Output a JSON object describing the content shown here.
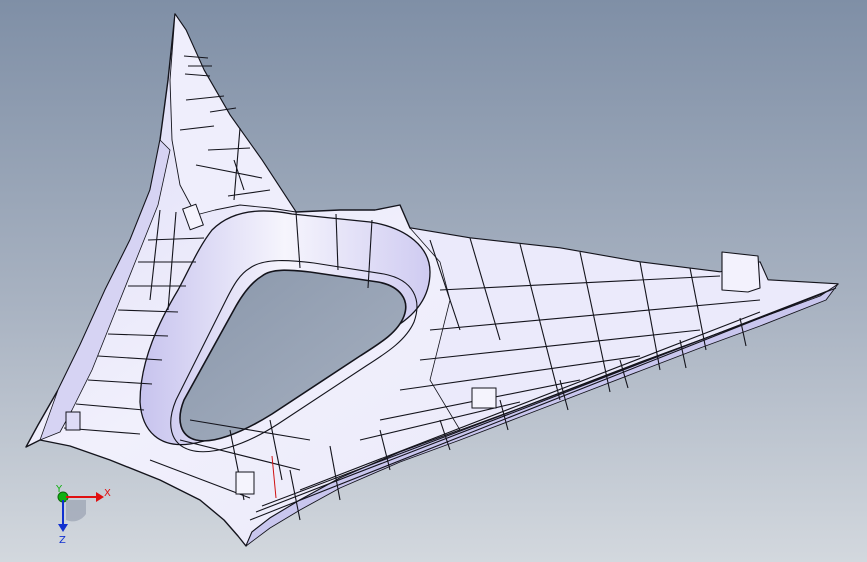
{
  "viewport": {
    "background_top": "#7f8fa6",
    "background_bottom": "#d3d8de",
    "part_fill": "#ecebfa",
    "part_shade": "#c9c6ee",
    "edge_color": "#14141c"
  },
  "triad": {
    "x_label": "X",
    "y_label": "Y",
    "z_label": "Z",
    "x_color": "#e01010",
    "y_color": "#10b010",
    "z_color": "#1030d0"
  }
}
